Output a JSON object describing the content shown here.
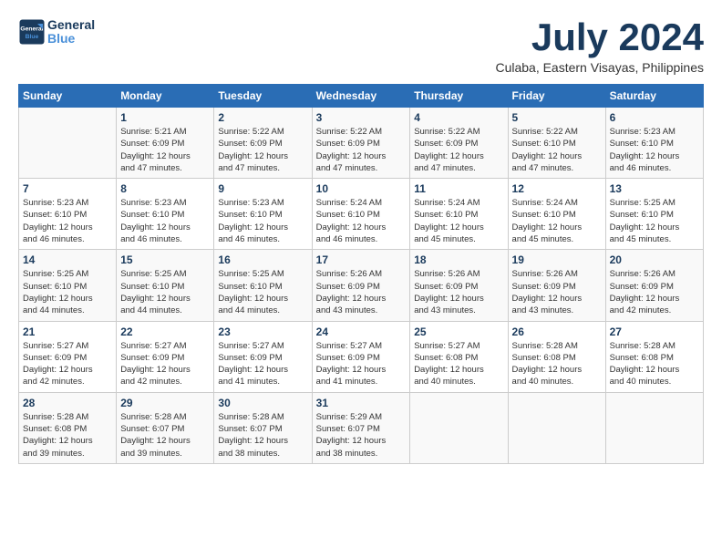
{
  "header": {
    "logo_line1": "General",
    "logo_line2": "Blue",
    "month": "July 2024",
    "location": "Culaba, Eastern Visayas, Philippines"
  },
  "days_of_week": [
    "Sunday",
    "Monday",
    "Tuesday",
    "Wednesday",
    "Thursday",
    "Friday",
    "Saturday"
  ],
  "weeks": [
    [
      {
        "day": "",
        "info": ""
      },
      {
        "day": "1",
        "info": "Sunrise: 5:21 AM\nSunset: 6:09 PM\nDaylight: 12 hours\nand 47 minutes."
      },
      {
        "day": "2",
        "info": "Sunrise: 5:22 AM\nSunset: 6:09 PM\nDaylight: 12 hours\nand 47 minutes."
      },
      {
        "day": "3",
        "info": "Sunrise: 5:22 AM\nSunset: 6:09 PM\nDaylight: 12 hours\nand 47 minutes."
      },
      {
        "day": "4",
        "info": "Sunrise: 5:22 AM\nSunset: 6:09 PM\nDaylight: 12 hours\nand 47 minutes."
      },
      {
        "day": "5",
        "info": "Sunrise: 5:22 AM\nSunset: 6:10 PM\nDaylight: 12 hours\nand 47 minutes."
      },
      {
        "day": "6",
        "info": "Sunrise: 5:23 AM\nSunset: 6:10 PM\nDaylight: 12 hours\nand 46 minutes."
      }
    ],
    [
      {
        "day": "7",
        "info": "Sunrise: 5:23 AM\nSunset: 6:10 PM\nDaylight: 12 hours\nand 46 minutes."
      },
      {
        "day": "8",
        "info": "Sunrise: 5:23 AM\nSunset: 6:10 PM\nDaylight: 12 hours\nand 46 minutes."
      },
      {
        "day": "9",
        "info": "Sunrise: 5:23 AM\nSunset: 6:10 PM\nDaylight: 12 hours\nand 46 minutes."
      },
      {
        "day": "10",
        "info": "Sunrise: 5:24 AM\nSunset: 6:10 PM\nDaylight: 12 hours\nand 46 minutes."
      },
      {
        "day": "11",
        "info": "Sunrise: 5:24 AM\nSunset: 6:10 PM\nDaylight: 12 hours\nand 45 minutes."
      },
      {
        "day": "12",
        "info": "Sunrise: 5:24 AM\nSunset: 6:10 PM\nDaylight: 12 hours\nand 45 minutes."
      },
      {
        "day": "13",
        "info": "Sunrise: 5:25 AM\nSunset: 6:10 PM\nDaylight: 12 hours\nand 45 minutes."
      }
    ],
    [
      {
        "day": "14",
        "info": "Sunrise: 5:25 AM\nSunset: 6:10 PM\nDaylight: 12 hours\nand 44 minutes."
      },
      {
        "day": "15",
        "info": "Sunrise: 5:25 AM\nSunset: 6:10 PM\nDaylight: 12 hours\nand 44 minutes."
      },
      {
        "day": "16",
        "info": "Sunrise: 5:25 AM\nSunset: 6:10 PM\nDaylight: 12 hours\nand 44 minutes."
      },
      {
        "day": "17",
        "info": "Sunrise: 5:26 AM\nSunset: 6:09 PM\nDaylight: 12 hours\nand 43 minutes."
      },
      {
        "day": "18",
        "info": "Sunrise: 5:26 AM\nSunset: 6:09 PM\nDaylight: 12 hours\nand 43 minutes."
      },
      {
        "day": "19",
        "info": "Sunrise: 5:26 AM\nSunset: 6:09 PM\nDaylight: 12 hours\nand 43 minutes."
      },
      {
        "day": "20",
        "info": "Sunrise: 5:26 AM\nSunset: 6:09 PM\nDaylight: 12 hours\nand 42 minutes."
      }
    ],
    [
      {
        "day": "21",
        "info": "Sunrise: 5:27 AM\nSunset: 6:09 PM\nDaylight: 12 hours\nand 42 minutes."
      },
      {
        "day": "22",
        "info": "Sunrise: 5:27 AM\nSunset: 6:09 PM\nDaylight: 12 hours\nand 42 minutes."
      },
      {
        "day": "23",
        "info": "Sunrise: 5:27 AM\nSunset: 6:09 PM\nDaylight: 12 hours\nand 41 minutes."
      },
      {
        "day": "24",
        "info": "Sunrise: 5:27 AM\nSunset: 6:09 PM\nDaylight: 12 hours\nand 41 minutes."
      },
      {
        "day": "25",
        "info": "Sunrise: 5:27 AM\nSunset: 6:08 PM\nDaylight: 12 hours\nand 40 minutes."
      },
      {
        "day": "26",
        "info": "Sunrise: 5:28 AM\nSunset: 6:08 PM\nDaylight: 12 hours\nand 40 minutes."
      },
      {
        "day": "27",
        "info": "Sunrise: 5:28 AM\nSunset: 6:08 PM\nDaylight: 12 hours\nand 40 minutes."
      }
    ],
    [
      {
        "day": "28",
        "info": "Sunrise: 5:28 AM\nSunset: 6:08 PM\nDaylight: 12 hours\nand 39 minutes."
      },
      {
        "day": "29",
        "info": "Sunrise: 5:28 AM\nSunset: 6:07 PM\nDaylight: 12 hours\nand 39 minutes."
      },
      {
        "day": "30",
        "info": "Sunrise: 5:28 AM\nSunset: 6:07 PM\nDaylight: 12 hours\nand 38 minutes."
      },
      {
        "day": "31",
        "info": "Sunrise: 5:29 AM\nSunset: 6:07 PM\nDaylight: 12 hours\nand 38 minutes."
      },
      {
        "day": "",
        "info": ""
      },
      {
        "day": "",
        "info": ""
      },
      {
        "day": "",
        "info": ""
      }
    ]
  ]
}
